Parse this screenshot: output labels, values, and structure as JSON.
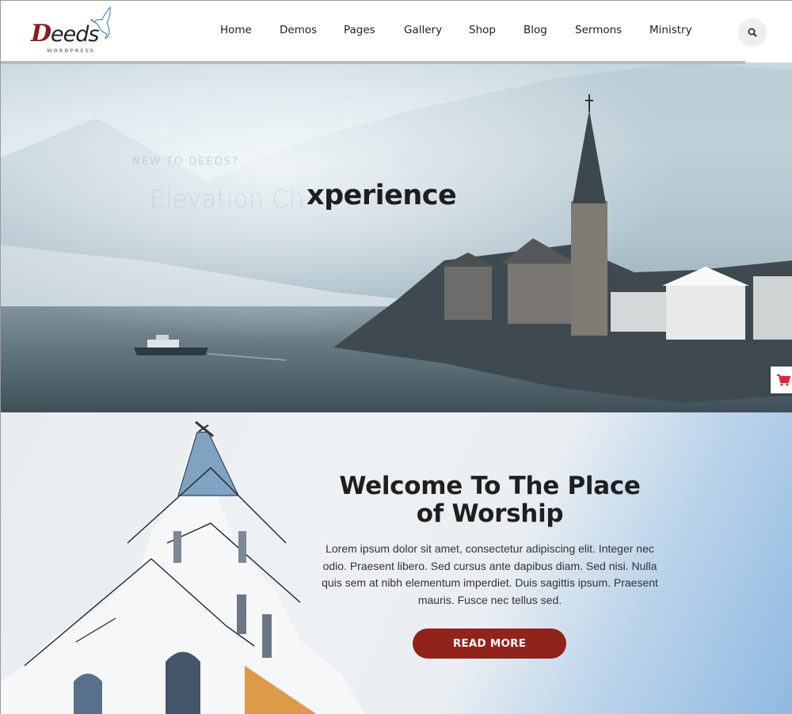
{
  "brand": {
    "logo_text_initial": "D",
    "logo_text_rest": "eeds",
    "logo_subtitle": "WORDPRESS"
  },
  "nav": {
    "items": [
      {
        "label": "Home"
      },
      {
        "label": "Demos"
      },
      {
        "label": "Pages"
      },
      {
        "label": "Gallery"
      },
      {
        "label": "Shop"
      },
      {
        "label": "Blog"
      },
      {
        "label": "Sermons"
      },
      {
        "label": "Ministry"
      }
    ],
    "search_icon": "search-icon"
  },
  "hero": {
    "eyebrow": "NEW TO DEEDS?",
    "ghost_title": "Elevation Ch",
    "title": "xperience",
    "cart_icon": "cart-icon",
    "colors": {
      "cart": "#e8213a"
    }
  },
  "welcome": {
    "title": "Welcome To The Place of Worship",
    "body": "Lorem ipsum dolor sit amet, consectetur adipiscing elit. Integer nec odio. Praesent libero. Sed cursus ante dapibus diam. Sed nisi. Nulla quis sem at nibh elementum imperdiet. Duis sagittis ipsum. Praesent mauris. Fusce nec tellus sed.",
    "button_label": "READ MORE",
    "colors": {
      "button": "#92231b"
    }
  }
}
